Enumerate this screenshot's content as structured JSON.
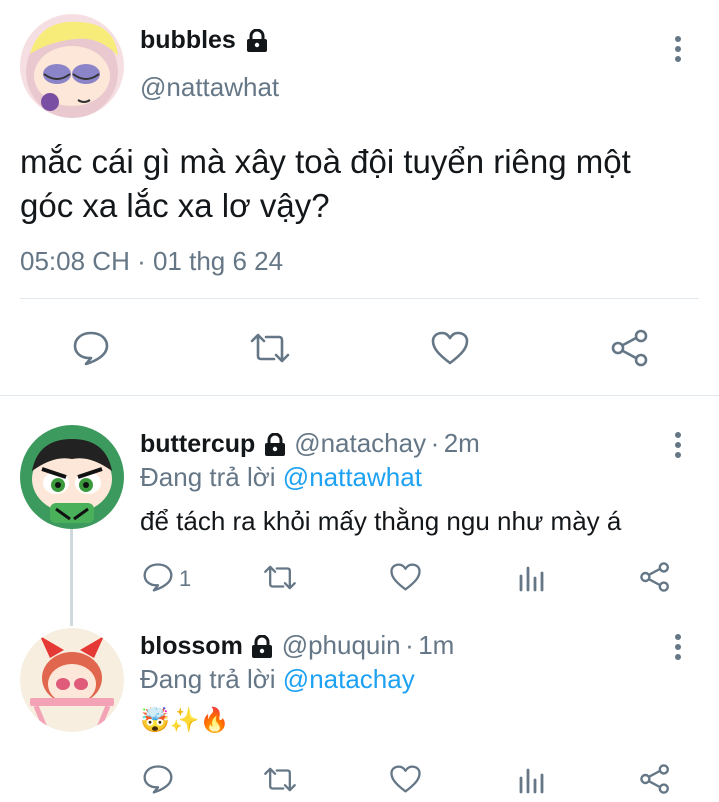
{
  "main_tweet": {
    "display_name": "bubbles",
    "handle": "@nattawhat",
    "text_line1": "mắc cái gì mà xây toà đội tuyển riêng một",
    "text_line2": "góc xa lắc xa lơ vậy?",
    "timestamp": "05:08 CH · 01 thg 6 24"
  },
  "replies": [
    {
      "display_name": "buttercup",
      "handle": "@natachay",
      "time": "2m",
      "replying_label": "Đang trả lời",
      "replying_to": "@nattawhat",
      "text": "để tách ra khỏi mấy thằng ngu như mày á",
      "reply_count": "1"
    },
    {
      "display_name": "blossom",
      "handle": "@phuquin",
      "time": "1m",
      "replying_label": "Đang trả lời",
      "replying_to": "@natachay",
      "text": "🤯✨🔥"
    }
  ],
  "colors": {
    "accent": "#1da1f2",
    "muted": "#657786",
    "divider": "#e1e8ed",
    "thread_line": "#cfd9de"
  },
  "icons": [
    "reply-icon",
    "retweet-icon",
    "like-icon",
    "share-icon",
    "analytics-icon",
    "lock-icon",
    "more-icon"
  ]
}
